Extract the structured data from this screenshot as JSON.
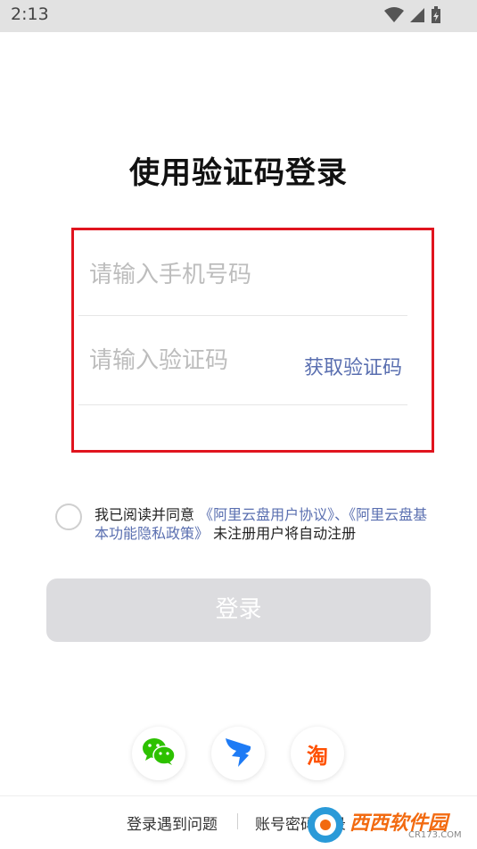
{
  "status_bar": {
    "time": "2:13",
    "icons": [
      "wifi-icon",
      "signal-icon",
      "battery-charging-icon"
    ]
  },
  "title": "使用验证码登录",
  "form": {
    "phone_placeholder": "请输入手机号码",
    "code_placeholder": "请输入验证码",
    "get_code_label": "获取验证码",
    "highlight_color": "#e0141e"
  },
  "agreement": {
    "prefix": "我已阅读并同意",
    "user_agreement": "《阿里云盘用户协议》",
    "separator": "、",
    "privacy_policy": "《阿里云盘基本功能隐私政策》",
    "suffix": " 未注册用户将自动注册",
    "checked": false,
    "link_color": "#5a6fb0"
  },
  "login_button": {
    "label": "登录",
    "enabled": false
  },
  "social_logins": [
    {
      "name": "wechat",
      "icon": "wechat-icon"
    },
    {
      "name": "dingtalk",
      "icon": "dingtalk-icon"
    },
    {
      "name": "taobao",
      "icon": "taobao-icon",
      "glyph": "淘"
    }
  ],
  "bottom_links": {
    "problem": "登录遇到问题",
    "password": "账号密码登录"
  },
  "watermark": {
    "text": "西西软件园",
    "sub": "CR173.COM"
  }
}
